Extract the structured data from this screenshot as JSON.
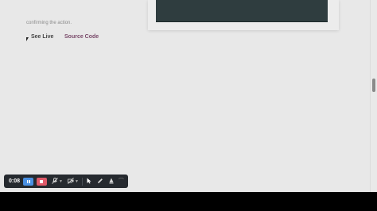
{
  "page": {
    "text_line1": "",
    "text_line2": "confirming the action.",
    "link_live": "See Live",
    "link_source": "Source Code"
  },
  "toolbar": {
    "timer": "0:08",
    "icons": [
      "pause-icon",
      "stop-icon",
      "microphone-off-icon",
      "camera-off-icon",
      "cursor-icon",
      "pen-icon",
      "highlighter-icon",
      "more-icon"
    ]
  },
  "colors": {
    "pause": "#4a90e2",
    "stop": "#e05a6a",
    "source_link": "#7a4a6a",
    "toolbar_bg": "#262a2f"
  }
}
